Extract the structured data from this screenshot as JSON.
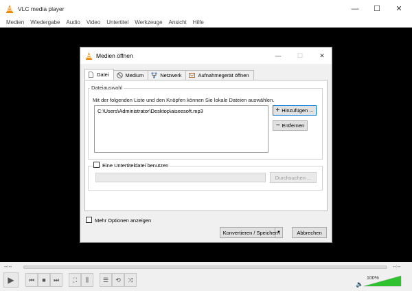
{
  "window": {
    "title": "VLC media player",
    "controls": {
      "minimize": "—",
      "maximize": "☐",
      "close": "✕"
    }
  },
  "menubar": {
    "items": [
      "Medien",
      "Wiedergabe",
      "Audio",
      "Video",
      "Untertitel",
      "Werkzeuge",
      "Ansicht",
      "Hilfe"
    ]
  },
  "dialog": {
    "title": "Medien öffnen",
    "tabs": [
      "Datei",
      "Medium",
      "Netzwerk",
      "Aufnahmegerät öffnen"
    ],
    "file_group": {
      "label": "Dateiauswahl",
      "info": "Mit der folgenden Liste und den Knöpfen können Sie lokale Dateien auswählen.",
      "files": [
        "C:\\Users\\Administrator\\Desktop\\aiseesoft.mp3"
      ],
      "add_button": "Hinzufügen ...",
      "remove_button": "Entfernen"
    },
    "subtitle": {
      "checkbox_label": "Eine Untertiteldatei benutzen",
      "browse_button": "Durchsuchen ..."
    },
    "more_options_label": "Mehr Optionen anzeigen",
    "convert_button": "Konvertieren / Speichern",
    "cancel_button": "Abbrechen"
  },
  "player": {
    "elapsed": "--:--",
    "remaining": "--:--",
    "volume_label": "100%",
    "volume_level": 1.0,
    "accent_color": "#e08000",
    "volume_color": "#2ec32e"
  }
}
